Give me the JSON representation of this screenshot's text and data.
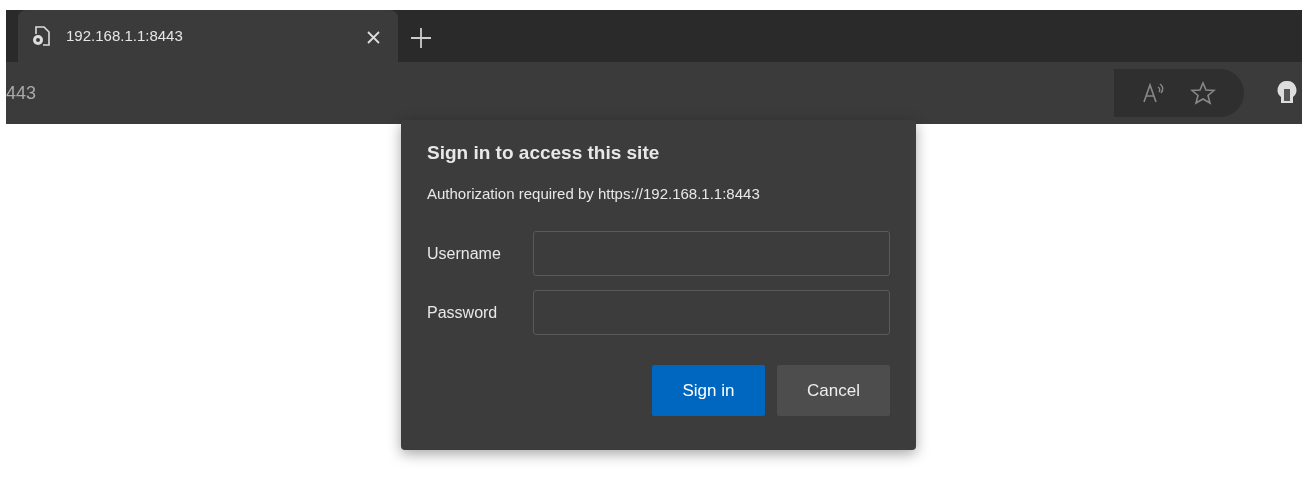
{
  "tabs": [
    {
      "title": "192.168.1.1:8443",
      "selected": true
    }
  ],
  "address_bar": {
    "text": "443"
  },
  "dialog": {
    "title": "Sign in to access this site",
    "message": "Authorization required by https://192.168.1.1:8443",
    "fields": [
      {
        "label": "Username"
      },
      {
        "label": "Password"
      }
    ],
    "buttons": [
      {
        "label": "Sign in",
        "kind": "primary"
      },
      {
        "label": "Cancel",
        "kind": "secondary"
      }
    ]
  }
}
